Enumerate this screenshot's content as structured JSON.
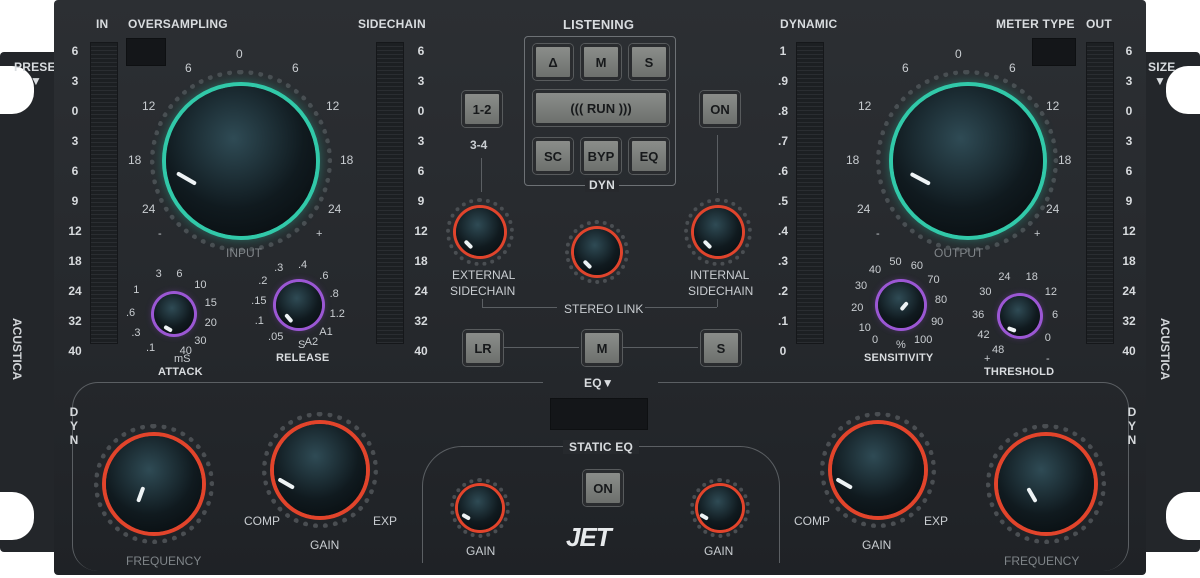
{
  "header": {
    "in": "IN",
    "oversampling": "OVERSAMPLING",
    "sidechain": "SIDECHAIN",
    "listening": "LISTENING",
    "dynamic": "DYNAMIC",
    "meter_type": "METER TYPE",
    "out": "OUT"
  },
  "side": {
    "presets": "PRESETS",
    "size": "SIZE",
    "brand": "ACUSTICA",
    "arrow": "▼"
  },
  "meters": {
    "db_scale": [
      "6",
      "3",
      "0",
      "3",
      "6",
      "9",
      "12",
      "18",
      "24",
      "32",
      "40"
    ],
    "dyn_scale": [
      "1",
      ".9",
      ".8",
      ".7",
      ".6",
      ".5",
      ".4",
      ".3",
      ".2",
      ".1",
      "0"
    ]
  },
  "listening": {
    "buttons": [
      "Δ",
      "M",
      "S"
    ],
    "run": "((( RUN )))",
    "bottom": [
      "SC",
      "BYP",
      "EQ"
    ],
    "dyn": "DYN"
  },
  "sidechain": {
    "btn_12": "1-2",
    "label_34": "3-4",
    "btn_on": "ON",
    "external": "EXTERNAL",
    "external2": "SIDECHAIN",
    "internal": "INTERNAL",
    "internal2": "SIDECHAIN",
    "stereo_link": "STEREO LINK",
    "lr": "LR",
    "m": "M",
    "s": "S",
    "eq_menu": "EQ▼"
  },
  "input_knob": {
    "label": "INPUT",
    "minus": "-",
    "plus": "+",
    "ticks_left": [
      "6",
      "12",
      "18",
      "24"
    ],
    "ticks_right": [
      "6",
      "12",
      "18",
      "24"
    ],
    "top": "0"
  },
  "output_knob": {
    "label": "OUTPUT",
    "minus": "-",
    "plus": "+",
    "ticks_left": [
      "6",
      "12",
      "18",
      "24"
    ],
    "ticks_right": [
      "6",
      "12",
      "18",
      "24"
    ],
    "top": "0"
  },
  "attack": {
    "label": "ATTACK",
    "unit": "mS",
    "ticks": [
      "3",
      "6",
      "10",
      "1",
      "15",
      ".6",
      "20",
      ".3",
      "30",
      ".1",
      "40"
    ]
  },
  "release": {
    "label": "RELEASE",
    "unit": "S",
    "ticks": [
      ".3",
      ".4",
      ".2",
      ".6",
      ".15",
      ".8",
      ".1",
      "1.2",
      ".05",
      "A1",
      "A2"
    ]
  },
  "sensitivity": {
    "label": "SENSITIVITY",
    "unit": "%",
    "ticks": [
      "50",
      "60",
      "40",
      "70",
      "30",
      "80",
      "20",
      "90",
      "10",
      "100",
      "0"
    ]
  },
  "threshold": {
    "label": "THRESHOLD",
    "plus": "+",
    "minus": "-",
    "ticks": [
      "24",
      "18",
      "30",
      "12",
      "36",
      "6",
      "42",
      "0",
      "48"
    ]
  },
  "eq": {
    "dyn_left": "DYN",
    "dyn_right": "DYN",
    "frequency": "FREQUENCY",
    "gain": "GAIN",
    "comp": "COMP",
    "exp": "EXP",
    "static_eq": "STATIC EQ",
    "on": "ON",
    "logo": "JET"
  },
  "colors": {
    "teal": "#35d0b0",
    "red": "#e2442b",
    "purple": "#a25bd9"
  }
}
